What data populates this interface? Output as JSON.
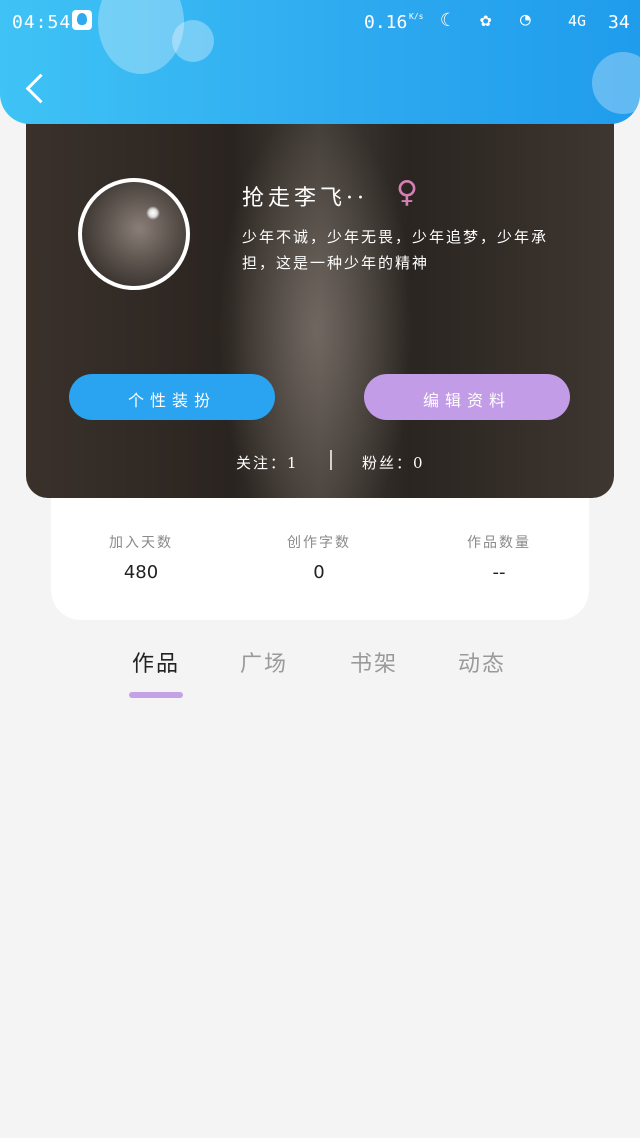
{
  "status_bar": {
    "time": "04:54",
    "network_speed": "0.16",
    "speed_unit": "K/s",
    "signal": "4G",
    "battery": "34"
  },
  "profile": {
    "username": "抢走李飞··",
    "gender": "female",
    "bio": "少年不诚，少年无畏，少年追梦，少年承担，这是一种少年的精神",
    "style_button": "个性装扮",
    "edit_button": "编辑资料",
    "follows_label": "关注：1",
    "fans_label": "粉丝：0"
  },
  "stats": [
    {
      "label": "加入天数",
      "value": "480"
    },
    {
      "label": "创作字数",
      "value": "0"
    },
    {
      "label": "作品数量",
      "value": "--"
    }
  ],
  "tabs": [
    {
      "label": "作品",
      "active": true
    },
    {
      "label": "广场",
      "active": false
    },
    {
      "label": "书架",
      "active": false
    },
    {
      "label": "动态",
      "active": false
    }
  ],
  "colors": {
    "header": "#2eaaf0",
    "style_button": "#2aa3f0",
    "edit_button": "#c29ce6",
    "tab_indicator": "#c3a2e6",
    "gender_icon": "#d77fb5"
  }
}
